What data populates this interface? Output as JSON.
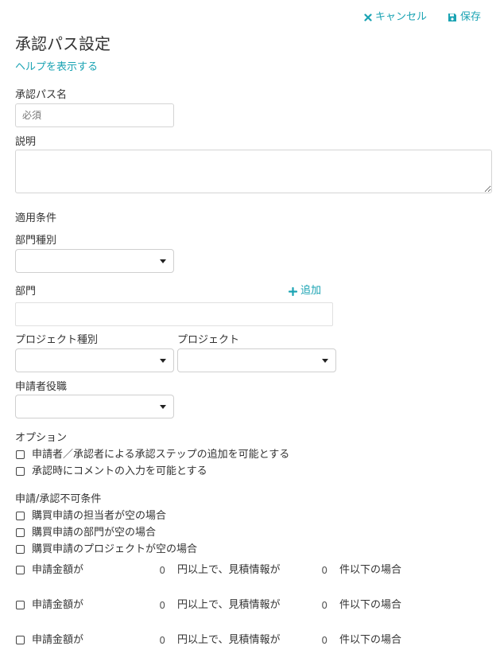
{
  "toolbar": {
    "cancel_label": "キャンセル",
    "save_label": "保存"
  },
  "page": {
    "title": "承認パス設定",
    "help_link": "ヘルプを表示する"
  },
  "form": {
    "name_label": "承認パス名",
    "name_placeholder": "必須",
    "description_label": "説明",
    "conditions_heading": "適用条件",
    "department_type_label": "部門種別",
    "department_label": "部門",
    "add_label": "追加",
    "project_type_label": "プロジェクト種別",
    "project_label": "プロジェクト",
    "applicant_role_label": "申請者役職"
  },
  "options": {
    "heading": "オプション",
    "items": [
      "申請者／承認者による承認ステップの追加を可能とする",
      "承認時にコメントの入力を可能とする"
    ]
  },
  "restrictions": {
    "heading": "申請/承認不可条件",
    "items": [
      "購買申請の担当者が空の場合",
      "購買申請の部門が空の場合",
      "購買申請のプロジェクトが空の場合"
    ],
    "amount_rows": [
      {
        "prefix": "申請金額が",
        "amount": "0",
        "middle": "円以上で、見積情報が",
        "count": "0",
        "suffix": "件以下の場合"
      },
      {
        "prefix": "申請金額が",
        "amount": "0",
        "middle": "円以上で、見積情報が",
        "count": "0",
        "suffix": "件以下の場合"
      },
      {
        "prefix": "申請金額が",
        "amount": "0",
        "middle": "円以上で、見積情報が",
        "count": "0",
        "suffix": "件以下の場合"
      }
    ]
  },
  "colors": {
    "accent": "#1aa3b3",
    "text": "#333333",
    "border": "#d4d4d4"
  }
}
